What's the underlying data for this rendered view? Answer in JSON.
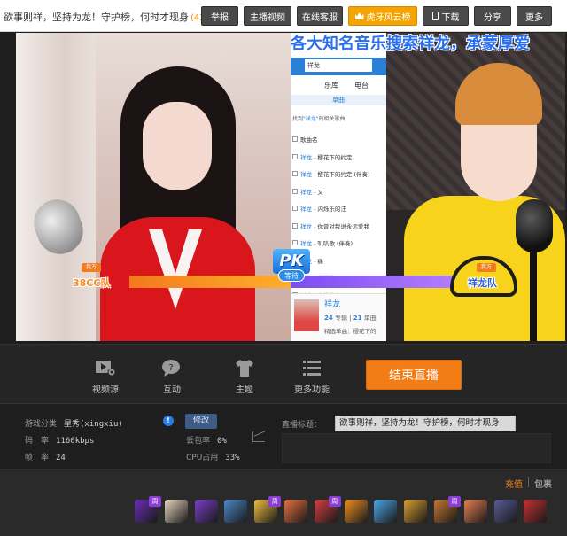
{
  "topbar": {
    "room_title": "欲事则祥，坚持为龙！守护榜，何时才现身",
    "room_count": "(420)",
    "buttons": {
      "report": "举报",
      "host_video": "主播视频",
      "support": "在线客服",
      "huya_cloud": "虎牙风云榜",
      "download": "下载",
      "share": "分享",
      "more": "更多"
    }
  },
  "stream": {
    "marquee": "各大知名音乐搜索祥龙，承蒙厚爱",
    "pk": {
      "logo": "PK",
      "status": "等待",
      "left_side_tag": "我方",
      "left_team": "38CC队",
      "right_side_tag": "我方",
      "right_team": "祥龙队"
    },
    "song_panel": {
      "search_query": "祥龙",
      "tabs": [
        "乐库",
        "电台"
      ],
      "subtab": "单曲",
      "hint_prefix": "找到",
      "hint_keyword": "\"祥龙\"",
      "hint_suffix": "的相关歌曲",
      "column_header": "歌曲名",
      "songs": [
        {
          "artist": "祥龙",
          "title": "樱花下的约定"
        },
        {
          "artist": "祥龙",
          "title": "樱花下的约定 (伴奏)"
        },
        {
          "artist": "祥龙",
          "title": "又"
        },
        {
          "artist": "祥龙",
          "title": "闪烁乐的汪"
        },
        {
          "artist": "祥龙",
          "title": "你曾对我说永远爱我"
        },
        {
          "artist": "祥龙",
          "title": "叭叭歌 (伴奏)"
        },
        {
          "artist": "祥龙",
          "title": "痛"
        },
        {
          "artist": "祥龙",
          "title": "战神曲"
        },
        {
          "artist": "祥龙",
          "title": "人的故事"
        },
        {
          "artist": "祥龙",
          "title": "人的故事"
        }
      ],
      "card": {
        "name": "祥龙",
        "albums": "24",
        "albums_label": "专辑",
        "singles": "21",
        "singles_label": "单曲",
        "featured": "精选单曲：樱花下的"
      }
    }
  },
  "controls": {
    "items": [
      {
        "label": "视频源",
        "icon": "video-source-icon"
      },
      {
        "label": "互动",
        "icon": "chat-bubble-icon"
      },
      {
        "label": "主题",
        "icon": "tshirt-icon"
      },
      {
        "label": "更多功能",
        "icon": "list-icon"
      }
    ],
    "end_live": "结束直播"
  },
  "info": {
    "category_label": "游戏分类",
    "category_value": "星秀(xingxiu)",
    "bitrate_label": "码　率",
    "bitrate_value": "1160kbps",
    "fps_label": "帧　率",
    "fps_value": "24",
    "edit": "修改",
    "packet_loss_label": "丢包率",
    "packet_loss_value": "0%",
    "cpu_label": "CPU占用",
    "cpu_value": "33%",
    "live_title_label": "直播标题：",
    "live_title_value": "欲事则祥，坚持为龙！守护榜，何时才现身"
  },
  "gifts": {
    "recharge": "充值",
    "package": "包裹",
    "zhou": "周",
    "items": [
      {
        "name": "周星榜",
        "color": "#6a2fb8"
      },
      {
        "name": "gift-card",
        "color": "#e8d5c0"
      },
      {
        "name": "lightsaber",
        "color": "#7a3fc8"
      },
      {
        "name": "sword",
        "color": "#4a8ac8"
      },
      {
        "name": "emoji-face",
        "color": "#f0c040"
      },
      {
        "name": "cake",
        "color": "#e87040"
      },
      {
        "name": "bottle",
        "color": "#d84040"
      },
      {
        "name": "car",
        "color": "#f09020"
      },
      {
        "name": "landscape",
        "color": "#4aa8e8"
      },
      {
        "name": "treasure",
        "color": "#d8a030"
      },
      {
        "name": "ship",
        "color": "#c87830"
      },
      {
        "name": "box",
        "color": "#e88050"
      },
      {
        "name": "frame",
        "color": "#5a5a9a"
      },
      {
        "name": "chest",
        "color": "#c83030"
      }
    ]
  }
}
